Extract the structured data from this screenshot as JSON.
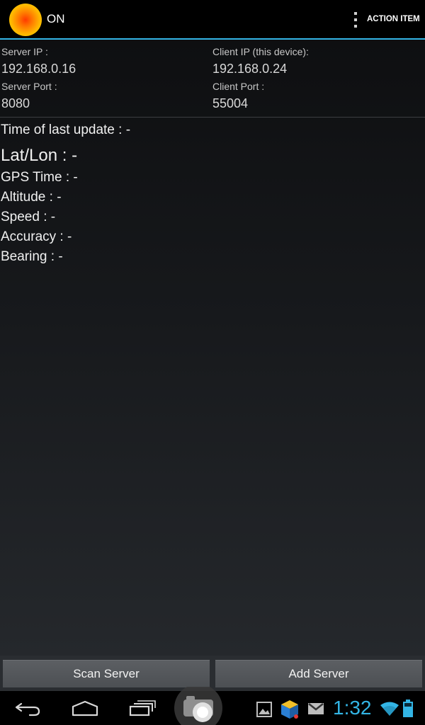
{
  "action_bar": {
    "title": "ON",
    "action_item_label": "ACTION ITEM",
    "accent_color": "#33b5e5"
  },
  "connection": {
    "server_ip_label": "Server IP :",
    "server_ip_value": "192.168.0.16",
    "server_port_label": "Server Port :",
    "server_port_value": "8080",
    "client_ip_label": "Client IP (this device):",
    "client_ip_value": "192.168.0.24",
    "client_port_label": "Client Port :",
    "client_port_value": "55004"
  },
  "status": {
    "last_update": "Time of last update : -",
    "lat_lon": "Lat/Lon : -",
    "gps_time": "GPS Time : -",
    "altitude": "Altitude : -",
    "speed": "Speed : -",
    "accuracy": "Accuracy : -",
    "bearing": "Bearing : -"
  },
  "buttons": {
    "scan_server": "Scan Server",
    "add_server": "Add Server"
  },
  "system_bar": {
    "time": "1:32",
    "icons": [
      "back-icon",
      "home-icon",
      "recent-apps-icon",
      "camera-icon",
      "gallery-icon",
      "box-app-icon",
      "gmail-icon",
      "wifi-icon",
      "battery-icon"
    ]
  }
}
